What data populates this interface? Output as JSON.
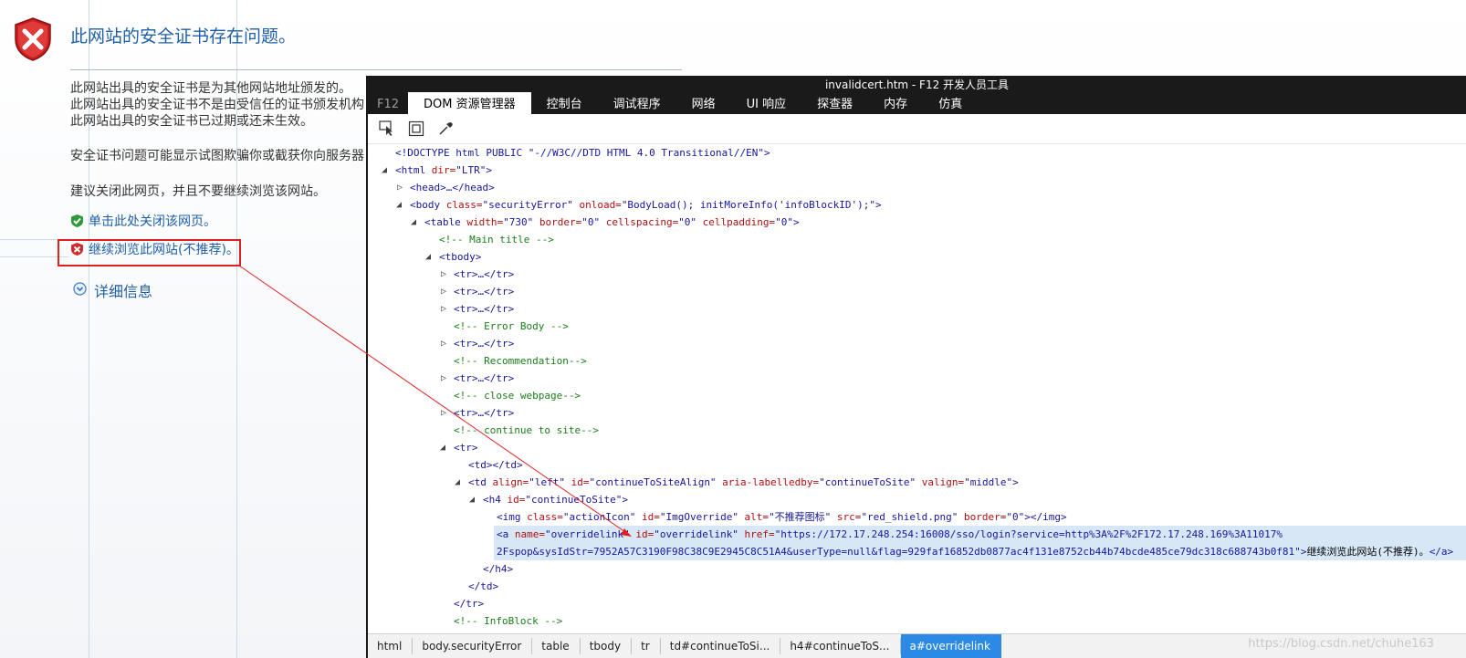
{
  "error_page": {
    "title": "此网站的安全证书存在问题。",
    "lines": [
      "此网站出具的安全证书是为其他网站地址颁发的。",
      "此网站出具的安全证书不是由受信任的证书颁发机构",
      "此网站出具的安全证书已过期或还未生效。"
    ],
    "warning": "安全证书问题可能显示试图欺骗你或截获你向服务器",
    "advice": "建议关闭此网页，并且不要继续浏览该网站。",
    "close_link": "单击此处关闭该网页。",
    "continue_link": "继续浏览此网站(不推荐)。",
    "details": "详细信息"
  },
  "devtools": {
    "title": "invalidcert.htm - F12 开发人员工具",
    "f12": "F12",
    "tabs": [
      "DOM 资源管理器",
      "控制台",
      "调试程序",
      "网络",
      "UI 响应",
      "探查器",
      "内存",
      "仿真"
    ],
    "active_tab": "DOM 资源管理器",
    "toolbar": [
      "select-element-icon",
      "highlight-element-icon",
      "color-picker-icon"
    ],
    "dom": {
      "doctype": "<!DOCTYPE html PUBLIC \"-//W3C//DTD HTML 4.0 Transitional//EN\">",
      "html_open": "<html",
      "html_attr": " dir=",
      "html_val": "\"LTR\"",
      "head": "<head>…</head>",
      "body_open": "<body",
      "body_attr1": " class=",
      "body_val1": "\"securityError\"",
      "body_attr2": " onload=",
      "body_val2": "\"BodyLoad(); initMoreInfo('infoBlockID');\"",
      "table_open": "<table",
      "table_attr1": " width=",
      "table_val1": "\"730\"",
      "table_attr2": " border=",
      "table_val2": "\"0\"",
      "table_attr3": " cellspacing=",
      "table_val3": "\"0\"",
      "table_attr4": " cellpadding=",
      "table_val4": "\"0\"",
      "c_main": "<!-- Main title -->",
      "tbody": "<tbody>",
      "tr_collapsed": "<tr>…</tr>",
      "c_error": "<!-- Error Body -->",
      "c_reco": "<!-- Recommendation-->",
      "c_close": "<!-- close webpage-->",
      "c_continue": "<!-- continue to site-->",
      "tr_open": "<tr>",
      "td_empty": "<td></td>",
      "td_open": "<td",
      "td_attr1": " align=",
      "td_val1": "\"left\"",
      "td_attr2": " id=",
      "td_val2": "\"continueToSiteAlign\"",
      "td_attr3": " aria-labelledby=",
      "td_val3": "\"continueToSite\"",
      "td_attr4": " valign=",
      "td_val4": "\"middle\"",
      "h4_open": "<h4",
      "h4_attr": " id=",
      "h4_val": "\"continueToSite\"",
      "img_open": "<img",
      "img_attr1": " class=",
      "img_val1": "\"actionIcon\"",
      "img_attr2": " id=",
      "img_val2": "\"ImgOverride\"",
      "img_attr3": " alt=",
      "img_val3": "\"不推荐图标\"",
      "img_attr4": " src=",
      "img_val4": "\"red_shield.png\"",
      "img_attr5": " border=",
      "img_val5": "\"0\"",
      "img_close": "></img>",
      "a_open": "<a",
      "a_attr1": " name=",
      "a_val1": "\"overridelink\"",
      "a_attr2": " id=",
      "a_val2": "\"overridelink\"",
      "a_attr3": " href=",
      "a_val3": "\"https://172.17.248.254:16008/sso/login?service=http%3A%2F%2F172.17.248.169%3A11017%",
      "a_val3b": "2Fspop&sysIdStr=7952A57C3190F98C38C9E2945C8C51A4&userType=null&flag=929faf16852db0877ac4f131e8752cb44b74bcde485ce79dc318c688743b0f81\"",
      "a_text": "继续浏览此网站(不推荐)。",
      "a_close": "</a>",
      "h4_close": "</h4>",
      "td_close": "</td>",
      "tr_close": "</tr>",
      "c_info": "<!-- InfoBlock -->"
    },
    "breadcrumbs": [
      "html",
      "body.securityError",
      "table",
      "tbody",
      "tr",
      "td#continueToSi...",
      "h4#continueToS...",
      "a#overridelink"
    ],
    "active_breadcrumb": "a#overridelink"
  },
  "watermark": "https://blog.csdn.net/chuhe163",
  "colors": {
    "link": "#1f5fa8",
    "highlight_box": "#e02020",
    "arrow": "#e02020",
    "active_breadcrumb": "#2a8ae6"
  }
}
